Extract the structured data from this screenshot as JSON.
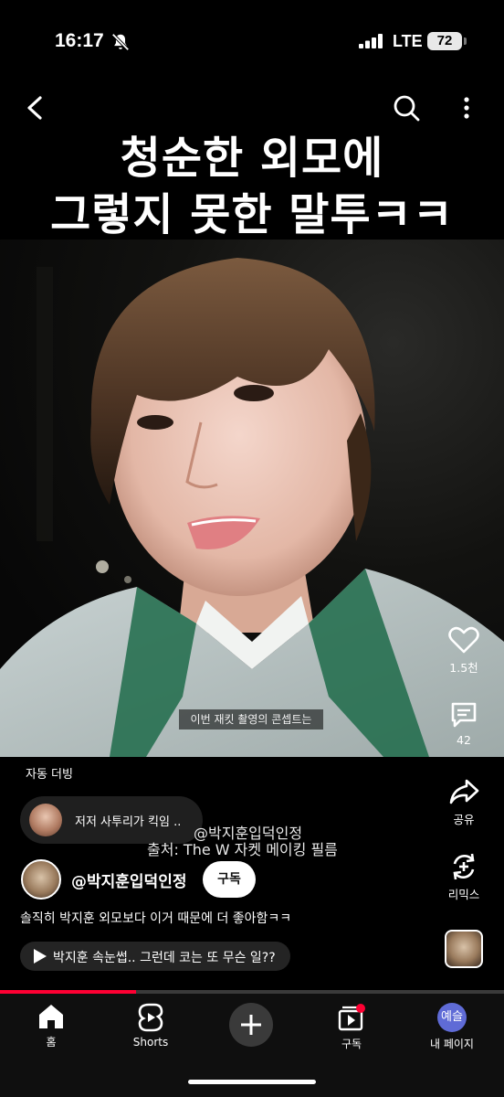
{
  "status_bar": {
    "time": "16:17",
    "network": "LTE",
    "battery": "72",
    "icons": [
      "bell-muted-icon",
      "signal-icon"
    ]
  },
  "top_nav": {
    "icons": [
      "back-icon",
      "search-icon",
      "more-vert-icon"
    ]
  },
  "video": {
    "headline_line1": "청순한 외모에",
    "headline_line2": "그렇지 못한 말투ㅋㅋ",
    "subtitle": "이번 재킷 촬영의 콘셉트는"
  },
  "actions": {
    "like_count": "1.5천",
    "comment_count": "42",
    "share_label": "공유",
    "remix_label": "리믹스"
  },
  "info": {
    "dub_label": "자동 더빙",
    "related_text": "저저 사투리가 킥임 ..",
    "source_handle": "@박지훈입덕인정",
    "source_title": "출처: The W 자켓 메이킹 필름",
    "channel_name": "@박지훈입덕인정",
    "subscribe_label": "구독",
    "description": "솔직히 박지훈 외모보다 이거 때문에 더 좋아함ㅋㅋ",
    "playlist_text": "박지훈 속눈썹.. 그런데 코는 또 무슨 일??"
  },
  "progress": {
    "fraction": 0.27
  },
  "bottom_nav": {
    "home": "홈",
    "shorts": "Shorts",
    "subscriptions": "구독",
    "profile_badge": "예슬",
    "my_page": "내 페이지"
  },
  "colors": {
    "accent_red": "#ff0033",
    "profile_purple": "#5f6bd6",
    "background": "#000000"
  }
}
